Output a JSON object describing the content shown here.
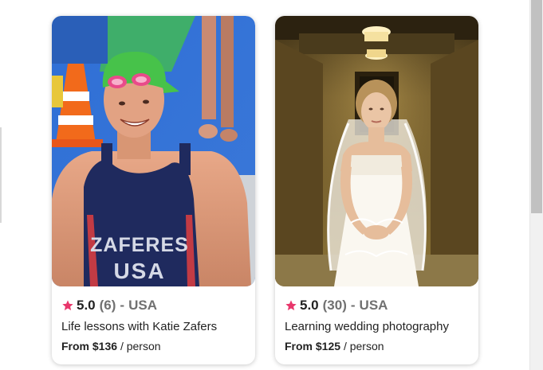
{
  "theme": {
    "star_color": "#e8366b",
    "muted_text": "#717171"
  },
  "cards": [
    {
      "image_alt": "Athlete in green swim cap and goggles wearing ZAFERES USA race suit",
      "jersey_lines": [
        "ZAFERES",
        "USA"
      ],
      "rating": "5.0",
      "count": "(6)",
      "separator": "-",
      "country": "USA",
      "title": "Life lessons with Katie Zafers",
      "price": "From $136",
      "per": "/ person"
    },
    {
      "image_alt": "Bride in white lace gown and veil in a marble hallway",
      "rating": "5.0",
      "count": "(30)",
      "separator": "-",
      "country": "USA",
      "title": "Learning wedding photography",
      "price": "From $125",
      "per": "/ person"
    }
  ]
}
